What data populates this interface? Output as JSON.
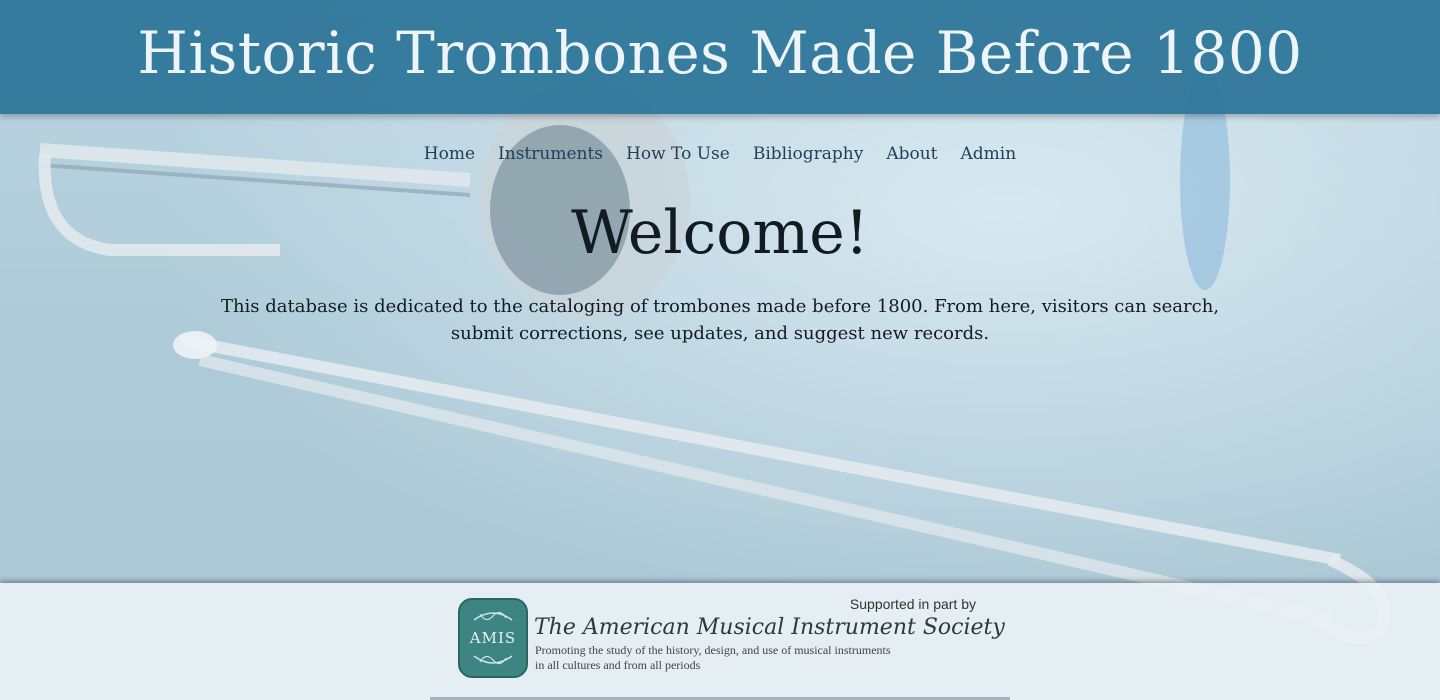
{
  "header": {
    "title": "Historic Trombones Made Before 1800"
  },
  "nav": {
    "items": [
      "Home",
      "Instruments",
      "How To Use",
      "Bibliography",
      "About",
      "Admin"
    ]
  },
  "main": {
    "heading": "Welcome!",
    "intro": "This database is dedicated to the cataloging of trombones made before 1800. From here, visitors can search, submit corrections, see updates, and suggest new records."
  },
  "footer": {
    "supported_label": "Supported in part by",
    "badge_text": "AMIS",
    "society_name": "The American Musical Instrument Society",
    "tagline_line1": "Promoting the study of the history, design, and use of musical instruments",
    "tagline_line2": "in all cultures and from all periods"
  },
  "colors": {
    "header_bg": "#2b7499",
    "nav_link": "#213f5a",
    "badge": "#3d8583"
  }
}
